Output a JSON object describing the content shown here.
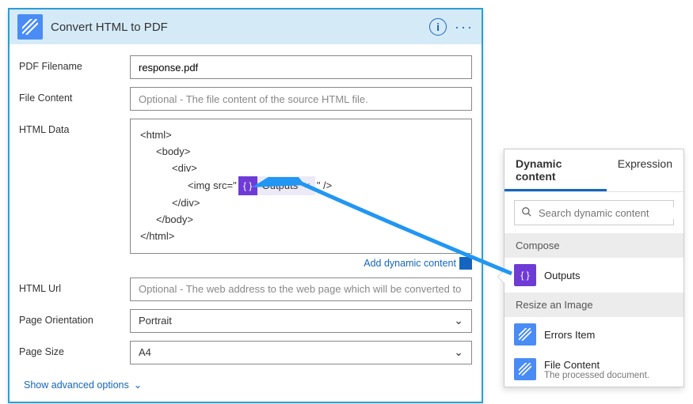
{
  "header": {
    "title": "Convert HTML to PDF"
  },
  "fields": {
    "pdfFilename": {
      "label": "PDF Filename",
      "value": "response.pdf"
    },
    "fileContent": {
      "label": "File Content",
      "placeholder": "Optional - The file content of the source HTML file."
    },
    "htmlData": {
      "label": "HTML Data",
      "lines": {
        "l1": "<html>",
        "l2": "<body>",
        "l3": "<div>",
        "l4a": "<img src=\" ",
        "token": "Outputs",
        "l4b": " \" />",
        "l5": "</div>",
        "l6": "</body>",
        "l7": "</html>"
      },
      "addDynamic": "Add dynamic content"
    },
    "htmlUrl": {
      "label": "HTML Url",
      "placeholder": "Optional - The web address to the web page which will be converted to a PDF d"
    },
    "pageOrientation": {
      "label": "Page Orientation",
      "value": "Portrait"
    },
    "pageSize": {
      "label": "Page Size",
      "value": "A4"
    }
  },
  "advanced": "Show advanced options",
  "dcPanel": {
    "tabs": {
      "dynamic": "Dynamic content",
      "expression": "Expression"
    },
    "searchPlaceholder": "Search dynamic content",
    "sections": {
      "compose": "Compose",
      "resize": "Resize an Image"
    },
    "items": {
      "outputs": "Outputs",
      "errorsItem": "Errors Item",
      "fileContent": {
        "title": "File Content",
        "sub": "The processed document."
      }
    }
  }
}
